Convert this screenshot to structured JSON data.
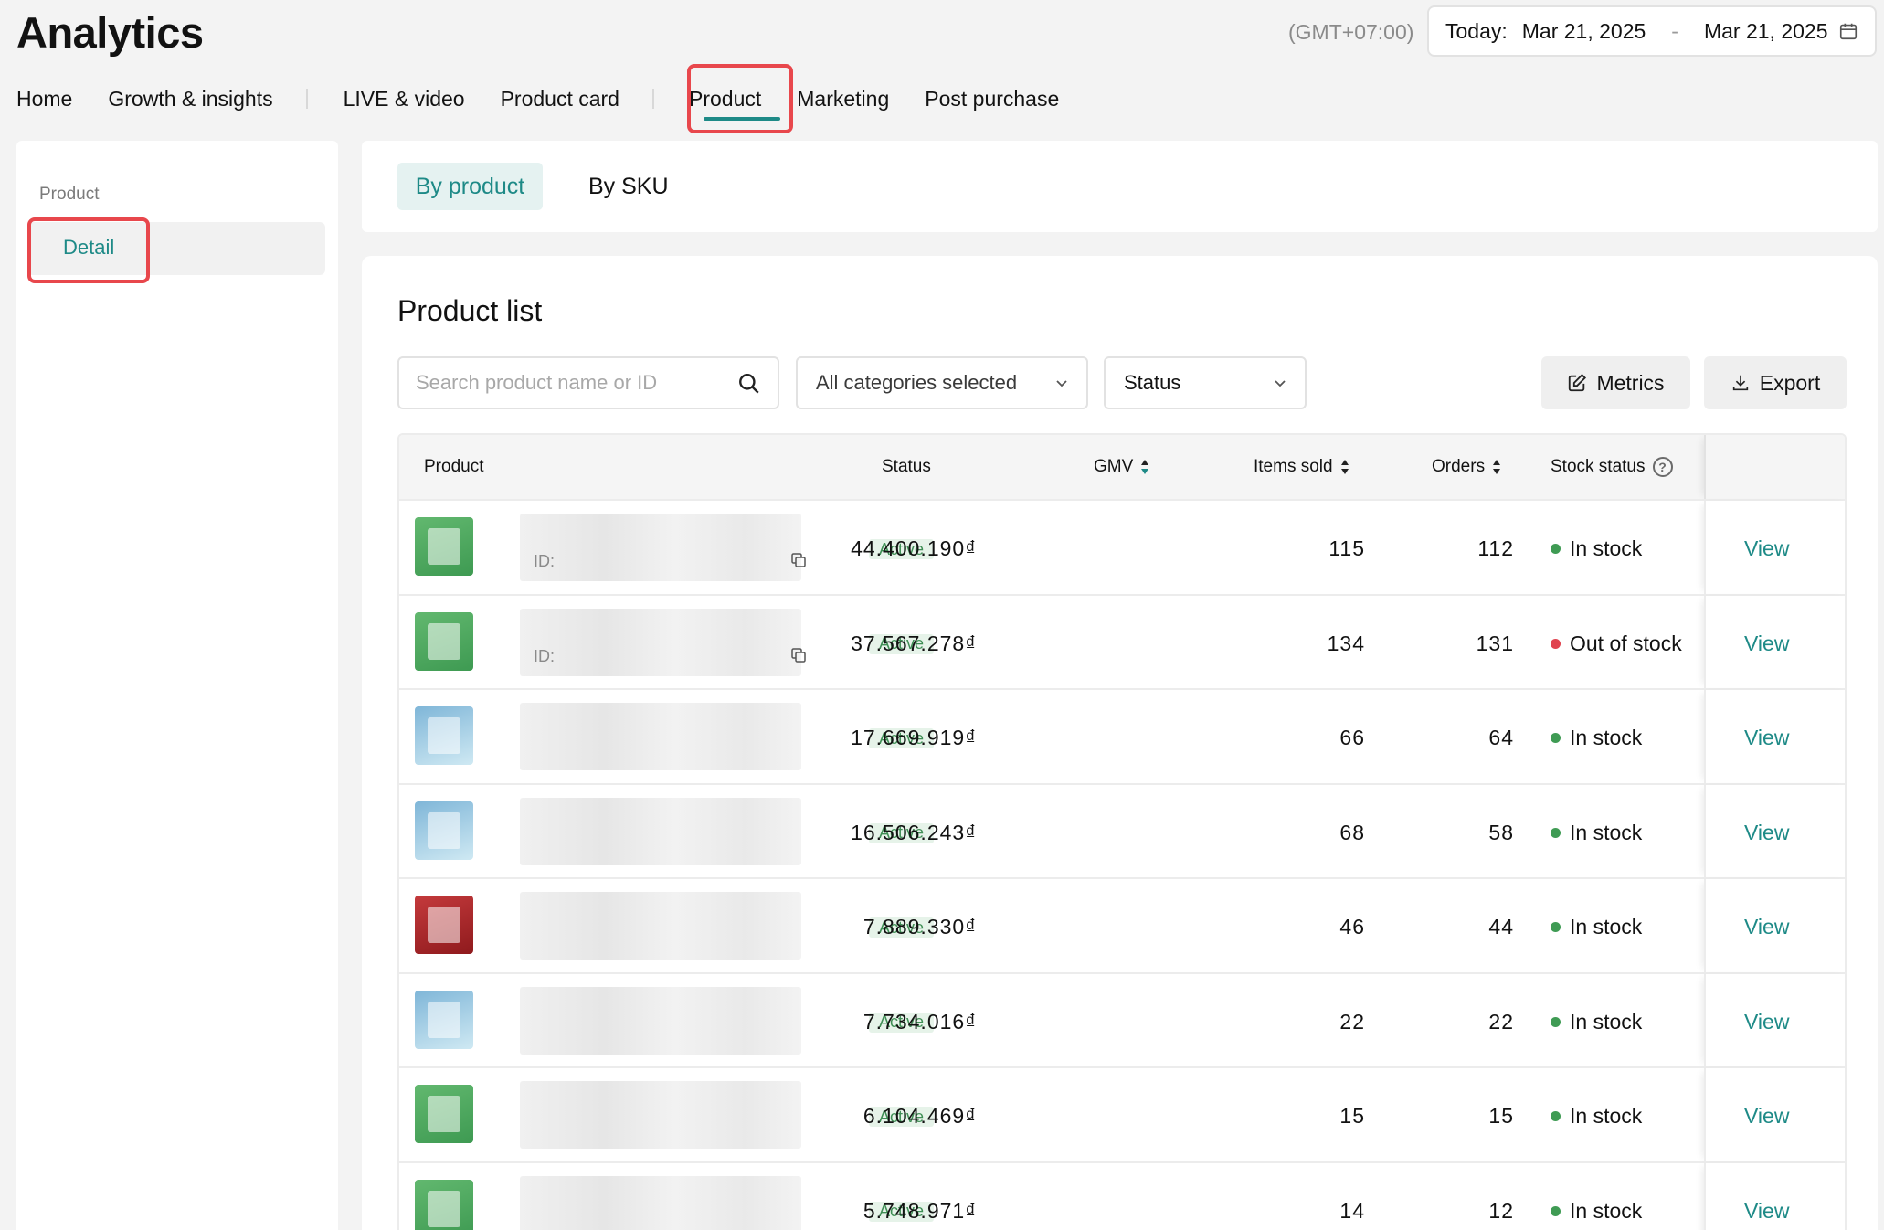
{
  "header": {
    "title": "Analytics",
    "timezone": "(GMT+07:00)",
    "date_prefix": "Today:",
    "date_start": "Mar 21, 2025",
    "date_sep": "-",
    "date_end": "Mar 21, 2025"
  },
  "nav": {
    "items": [
      "Home",
      "Growth & insights",
      "LIVE & video",
      "Product card",
      "Product",
      "Marketing",
      "Post purchase"
    ],
    "active": "Product"
  },
  "sidebar": {
    "section": "Product",
    "item": "Detail"
  },
  "view_toggle": {
    "active": "By product",
    "other": "By SKU"
  },
  "product_list": {
    "title": "Product list",
    "search_placeholder": "Search product name or ID",
    "category_filter": "All categories selected",
    "status_filter": "Status",
    "metrics_label": "Metrics",
    "export_label": "Export",
    "columns": [
      "Product",
      "Status",
      "GMV",
      "Items sold",
      "Orders",
      "Stock status"
    ],
    "id_prefix": "ID:",
    "view_label": "View",
    "rows": [
      {
        "status": "Active",
        "gmv": "44.400.190₫",
        "items_sold": "115",
        "orders": "112",
        "stock": "In stock",
        "stock_color": "#3f9b54",
        "thumb": "green"
      },
      {
        "status": "Active",
        "gmv": "37.567.278₫",
        "items_sold": "134",
        "orders": "131",
        "stock": "Out of stock",
        "stock_color": "#e0434f",
        "thumb": "green"
      },
      {
        "status": "Active",
        "gmv": "17.669.919₫",
        "items_sold": "66",
        "orders": "64",
        "stock": "In stock",
        "stock_color": "#3f9b54",
        "thumb": "blue"
      },
      {
        "status": "Active",
        "gmv": "16.506.243₫",
        "items_sold": "68",
        "orders": "58",
        "stock": "In stock",
        "stock_color": "#3f9b54",
        "thumb": "blue"
      },
      {
        "status": "Active",
        "gmv": "7.889.330₫",
        "items_sold": "46",
        "orders": "44",
        "stock": "In stock",
        "stock_color": "#3f9b54",
        "thumb": "red"
      },
      {
        "status": "Active",
        "gmv": "7.734.016₫",
        "items_sold": "22",
        "orders": "22",
        "stock": "In stock",
        "stock_color": "#3f9b54",
        "thumb": "blue"
      },
      {
        "status": "Active",
        "gmv": "6.104.469₫",
        "items_sold": "15",
        "orders": "15",
        "stock": "In stock",
        "stock_color": "#3f9b54",
        "thumb": "green"
      },
      {
        "status": "Active",
        "gmv": "5.748.971₫",
        "items_sold": "14",
        "orders": "12",
        "stock": "In stock",
        "stock_color": "#3f9b54",
        "thumb": "green"
      }
    ]
  },
  "colors": {
    "accent": "#1e8a87",
    "highlight": "#e8474c",
    "in_stock": "#3f9b54",
    "out_of_stock": "#e0434f"
  }
}
